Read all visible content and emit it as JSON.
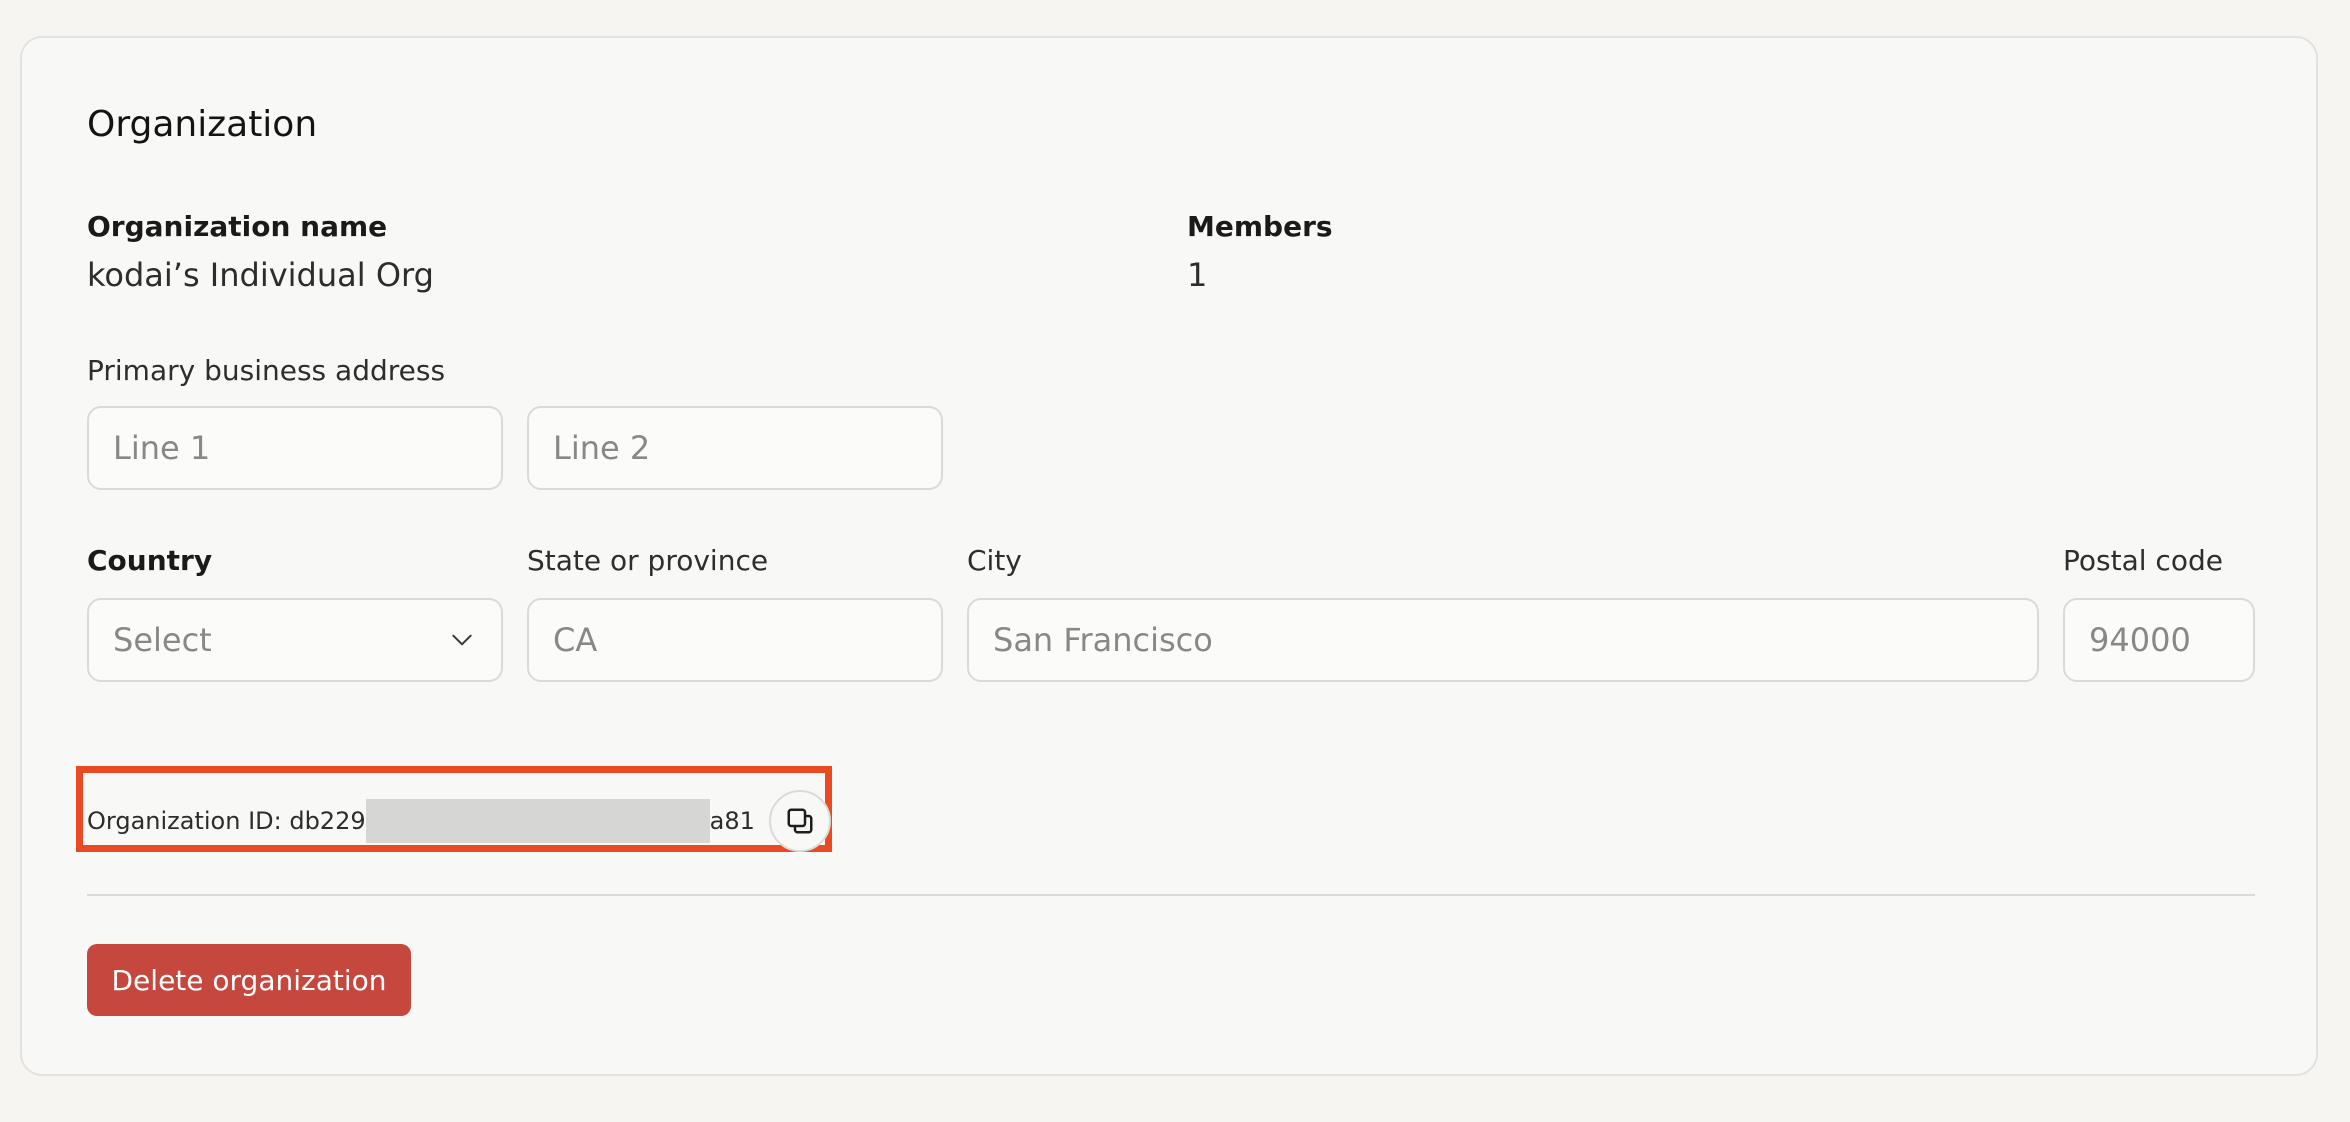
{
  "section": {
    "title": "Organization"
  },
  "org": {
    "name_label": "Organization name",
    "name_value": "kodai’s Individual Org",
    "members_label": "Members",
    "members_value": "1"
  },
  "address": {
    "label": "Primary business address",
    "line1_placeholder": "Line 1",
    "line2_placeholder": "Line 2",
    "country_label": "Country",
    "country_selected": "Select",
    "state_label": "State or province",
    "state_placeholder": "CA",
    "city_label": "City",
    "city_placeholder": "San Francisco",
    "postal_label": "Postal code",
    "postal_placeholder": "94000"
  },
  "org_id": {
    "prefix": "Organization ID: db229",
    "suffix": "a81",
    "copy_icon": "copy-icon"
  },
  "actions": {
    "delete_label": "Delete organization"
  },
  "colors": {
    "background": "#f6f5f1",
    "highlight": "#ea4a21",
    "danger": "#c5473d"
  }
}
